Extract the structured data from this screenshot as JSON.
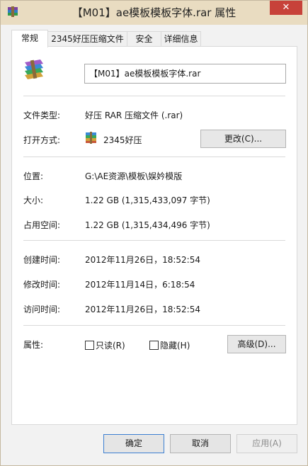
{
  "window": {
    "title": "【M01】ae模板模板字体.rar 属性",
    "close_glyph": "✕"
  },
  "tabs": [
    {
      "label": "常规",
      "active": true
    },
    {
      "label": "2345好压压缩文件",
      "active": false
    },
    {
      "label": "安全",
      "active": false
    },
    {
      "label": "详细信息",
      "active": false
    }
  ],
  "general": {
    "filename": "【M01】ae模板模板字体.rar",
    "file_type_label": "文件类型:",
    "file_type_value": "好压 RAR 压缩文件 (.rar)",
    "open_with_label": "打开方式:",
    "open_with_value": "2345好压",
    "change_button": "更改(C)...",
    "location_label": "位置:",
    "location_value": "G:\\AE资源\\模板\\娱妗模版",
    "size_label": "大小:",
    "size_value": "1.22 GB (1,315,433,097 字节)",
    "disk_size_label": "占用空间:",
    "disk_size_value": "1.22 GB (1,315,434,496 字节)",
    "created_label": "创建时间:",
    "created_value": "2012年11月26日，18:52:54",
    "modified_label": "修改时间:",
    "modified_value": "2012年11月14日，6:18:54",
    "accessed_label": "访问时间:",
    "accessed_value": "2012年11月26日，18:52:54",
    "attributes_label": "属性:",
    "readonly_label": "只读(R)",
    "readonly_checked": false,
    "hidden_label": "隐藏(H)",
    "hidden_checked": false,
    "advanced_button": "高级(D)..."
  },
  "footer": {
    "ok": "确定",
    "cancel": "取消",
    "apply": "应用(A)"
  },
  "colors": {
    "titlebar": "#e9dcc1",
    "close": "#c7423a",
    "accent_border": "#3c7fd1"
  },
  "icons": {
    "title": "winrar-archive-icon",
    "file": "winrar-archive-icon",
    "open_with": "2345-haozip-icon"
  }
}
